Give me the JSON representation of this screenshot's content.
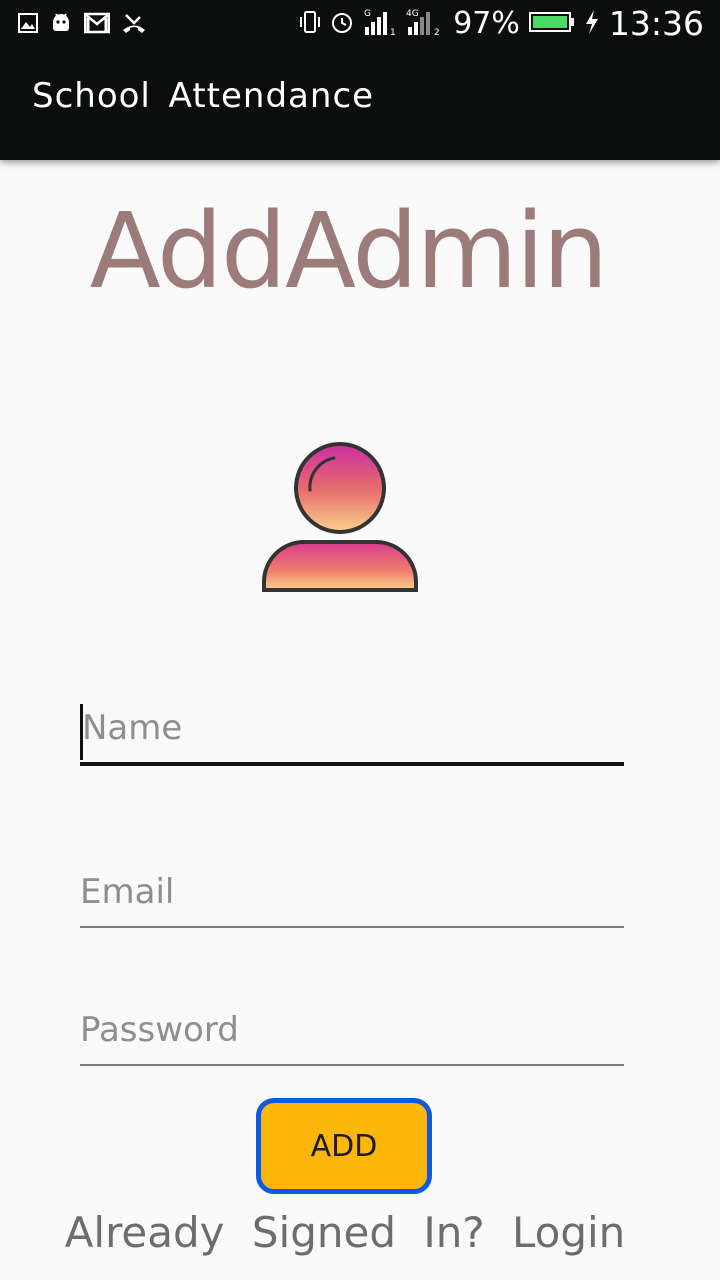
{
  "status_bar": {
    "battery_percent": "97%",
    "time": "13:36",
    "network_labels": [
      "G",
      "1",
      "4G",
      "2"
    ],
    "battery_color": "#4cd964",
    "icons": [
      "image-icon",
      "android-debug-icon",
      "gmail-icon",
      "missed-call-icon",
      "vibrate-icon",
      "alarm-icon",
      "signal-sim1-icon",
      "signal-sim2-icon",
      "battery-icon",
      "charging-icon"
    ]
  },
  "app_bar": {
    "title": "School Attendance"
  },
  "main": {
    "heading": "AddAdmin",
    "avatar_icon": "user-avatar-icon",
    "fields": {
      "name": {
        "placeholder": "Name",
        "value": ""
      },
      "email": {
        "placeholder": "Email",
        "value": ""
      },
      "password": {
        "placeholder": "Password",
        "value": ""
      }
    },
    "add_button": "ADD",
    "footer_link": "Already Signed In? Login"
  },
  "colors": {
    "bar_background": "#0c0d0d",
    "heading": "#9c7b7b",
    "button_fill": "#fdb60a",
    "button_border": "#0c5ae0",
    "avatar_gradient": [
      "#cc2fa3",
      "#fbd18a"
    ]
  }
}
